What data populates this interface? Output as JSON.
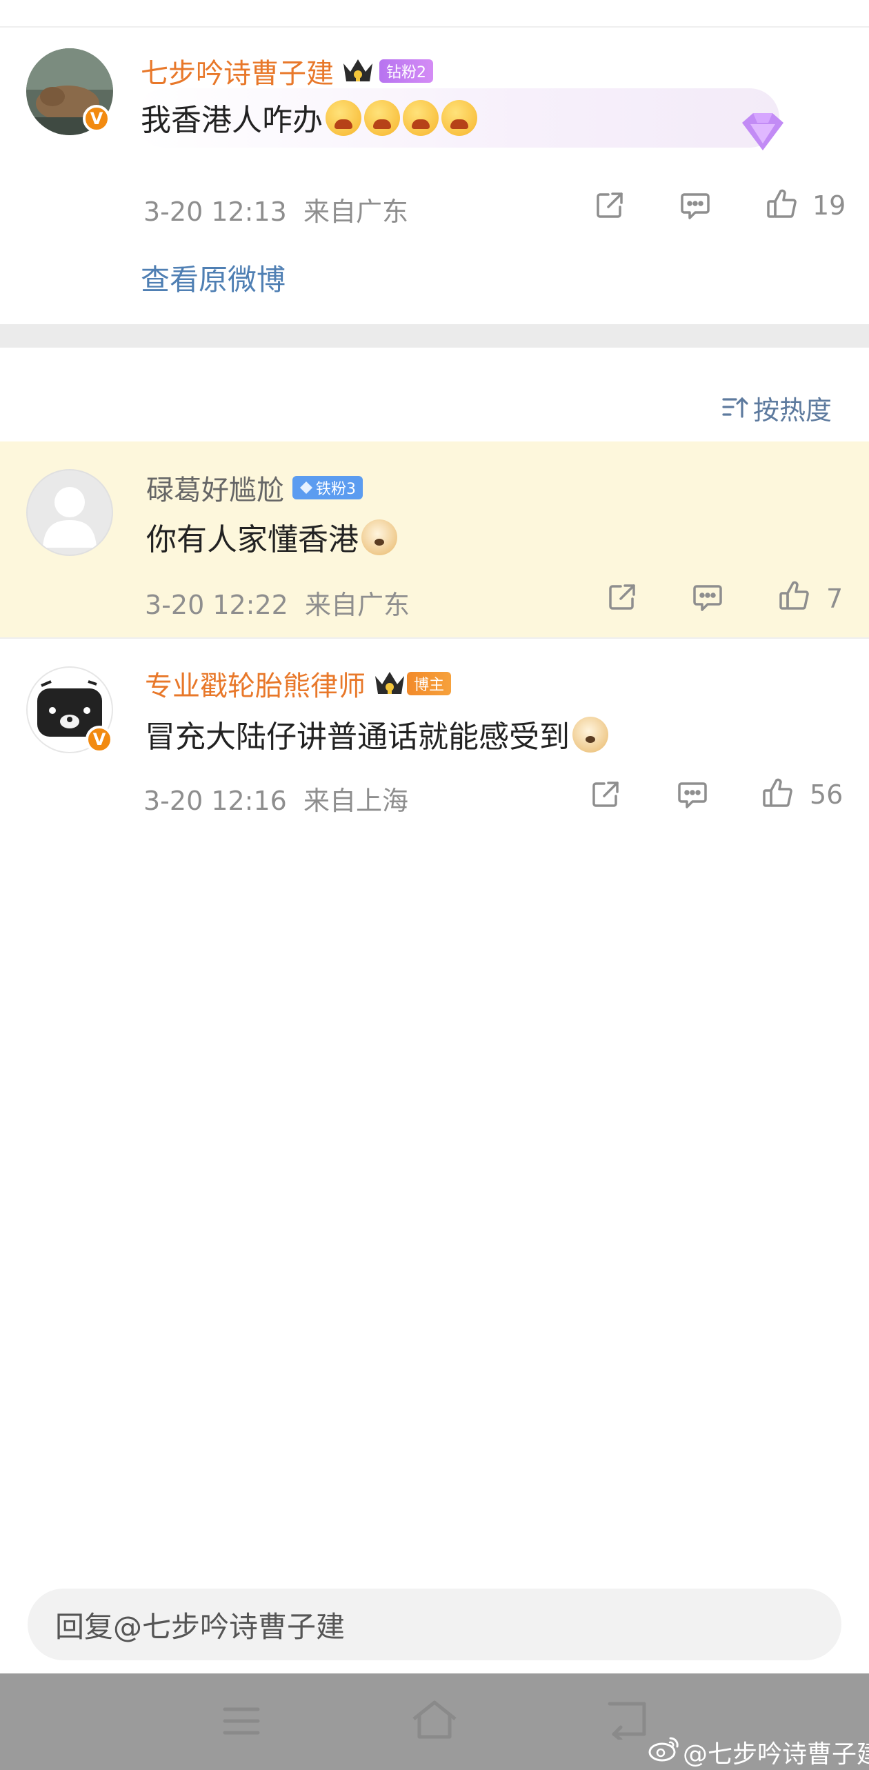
{
  "original_post": {
    "author": "七步吟诗曹子建",
    "fan_badge": "钻粉2",
    "text": "我香港人咋办",
    "timestamp": "3-20 12:13",
    "location": "来自广东",
    "like_count": "19",
    "view_original_link": "查看原微博"
  },
  "sort": {
    "label": "按热度"
  },
  "comments": [
    {
      "author": "碌葛好尴尬",
      "fan_badge": "铁粉3",
      "text": "你有人家懂香港",
      "timestamp": "3-20 12:22",
      "location": "来自广东",
      "like_count": "7",
      "highlighted": true
    },
    {
      "author": "专业戳轮胎熊律师",
      "fan_badge": "博主",
      "text": "冒充大陆仔讲普通话就能感受到",
      "timestamp": "3-20 12:16",
      "location": "来自上海",
      "like_count": "56",
      "highlighted": false
    }
  ],
  "reply_input": {
    "placeholder": "回复@七步吟诗曹子建"
  },
  "watermark": "@七步吟诗曹子建",
  "colors": {
    "author_name": "#e8782a",
    "link_blue": "#4f7fb3",
    "highlight_bg": "#fdf7dc",
    "divider_gray": "#ebebeb"
  }
}
